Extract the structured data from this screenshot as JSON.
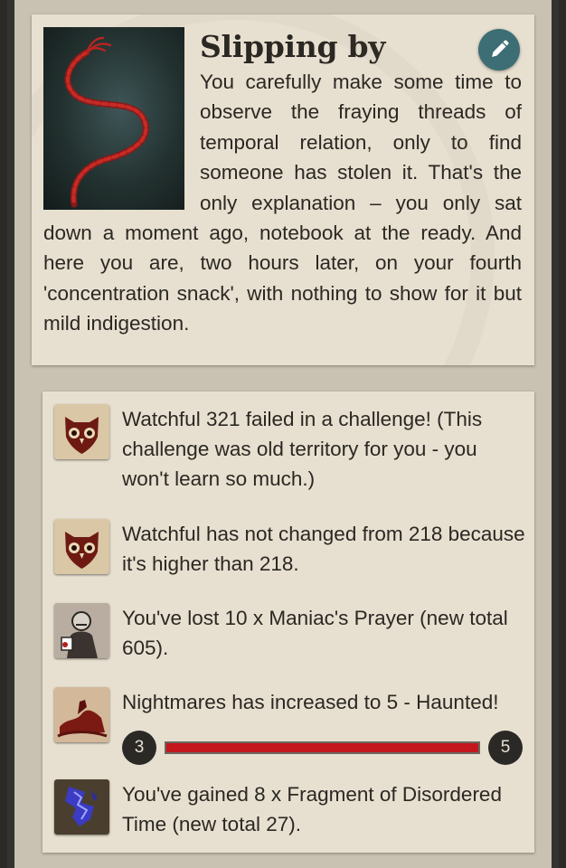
{
  "story": {
    "title": "Slipping by",
    "text": "You carefully make some time to observe the fraying threads of temporal relation, only to find someone has stolen it. That's the only explanation – you only sat down a moment ago, notebook at the ready. And here you are, two hours later, on your fourth 'concentration snack', with nothing to show for it but mild indigestion.",
    "image_icon": "red-rope-icon",
    "edit_icon": "pencil-icon"
  },
  "results": [
    {
      "icon": "owl-mask-icon",
      "text": "Watchful 321 failed in a challenge! (This challenge was old territory for you - you won't learn so much.)"
    },
    {
      "icon": "owl-mask-icon",
      "text": "Watchful has not changed from 218 because it's higher than 218."
    },
    {
      "icon": "maniac-figure-icon",
      "text": "You've lost 10 x Maniac's Prayer (new total 605)."
    },
    {
      "icon": "nightmare-rider-icon",
      "text": "Nightmares has increased to 5 - Haunted!",
      "progress": {
        "from": "3",
        "to": "5",
        "fill": 1.0
      }
    },
    {
      "icon": "blue-fragment-icon",
      "text": "You've gained 8 x Fragment of Disordered Time (new total 27)."
    }
  ],
  "colors": {
    "accent": "#3d6e76",
    "bar": "#c3171d",
    "card": "#e7e0d0"
  }
}
